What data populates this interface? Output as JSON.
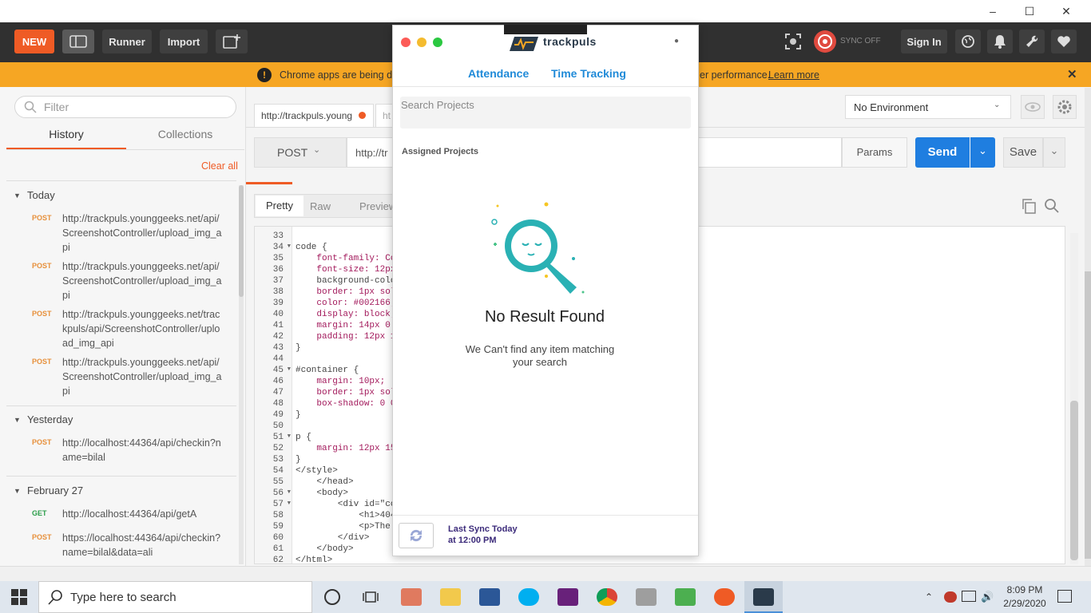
{
  "toolbar": {
    "new_label": "NEW",
    "runner_label": "Runner",
    "import_label": "Import",
    "sync_label": "SYNC OFF",
    "signin_label": "Sign In"
  },
  "banner": {
    "text_left": "Chrome apps are being de",
    "text_right": "er performance.",
    "link": "Learn more"
  },
  "sidebar": {
    "filter_placeholder": "Filter",
    "tabs": [
      "History",
      "Collections"
    ],
    "clear_all": "Clear all",
    "groups": [
      {
        "name": "Today",
        "items": [
          {
            "method": "POST",
            "url": "http://trackpuls.younggeeks.net/api/ScreenshotController/upload_img_api"
          },
          {
            "method": "POST",
            "url": "http://trackpuls.younggeeks.net/api/ScreenshotController/upload_img_api"
          },
          {
            "method": "POST",
            "url": "http://trackpuls.younggeeks.net/trackpuls/api/ScreenshotController/upload_img_api"
          },
          {
            "method": "POST",
            "url": "http://trackpuls.younggeeks.net/api/ScreenshotController/upload_img_api"
          }
        ]
      },
      {
        "name": "Yesterday",
        "items": [
          {
            "method": "POST",
            "url": "http://localhost:44364/api/checkin?name=bilal"
          }
        ]
      },
      {
        "name": "February 27",
        "items": [
          {
            "method": "GET",
            "url": "http://localhost:44364/api/getA"
          },
          {
            "method": "POST",
            "url": "https://localhost:44364/api/checkin?name=bilal&data=ali"
          }
        ]
      }
    ]
  },
  "request": {
    "tab_url": "http://trackpuls.young",
    "tab2": "ht",
    "method": "POST",
    "url": "http://tr",
    "params": "Params",
    "send": "Send",
    "save": "Save",
    "environment": "No Environment"
  },
  "response": {
    "tabs": [
      "Pretty",
      "Raw",
      "Preview"
    ]
  },
  "code_lines": [
    {
      "n": "33",
      "t": ""
    },
    {
      "n": "34",
      "t": "code {"
    },
    {
      "n": "35",
      "t": "    font-family: Co"
    },
    {
      "n": "36",
      "t": "    font-size: 12px"
    },
    {
      "n": "37",
      "t": "    background-colo"
    },
    {
      "n": "38",
      "t": "    border: 1px sol"
    },
    {
      "n": "39",
      "t": "    color: #002166;"
    },
    {
      "n": "40",
      "t": "    display: block;"
    },
    {
      "n": "41",
      "t": "    margin: 14px 0"
    },
    {
      "n": "42",
      "t": "    padding: 12px 1"
    },
    {
      "n": "43",
      "t": "}"
    },
    {
      "n": "44",
      "t": ""
    },
    {
      "n": "45",
      "t": "#container {"
    },
    {
      "n": "46",
      "t": "    margin: 10px;"
    },
    {
      "n": "47",
      "t": "    border: 1px sol"
    },
    {
      "n": "48",
      "t": "    box-shadow: 0 0"
    },
    {
      "n": "49",
      "t": "}"
    },
    {
      "n": "50",
      "t": ""
    },
    {
      "n": "51",
      "t": "p {"
    },
    {
      "n": "52",
      "t": "    margin: 12px 15"
    },
    {
      "n": "53",
      "t": "}"
    },
    {
      "n": "54",
      "t": "</style>"
    },
    {
      "n": "55",
      "t": "    </head>"
    },
    {
      "n": "56",
      "t": "    <body>"
    },
    {
      "n": "57",
      "t": "        <div id=\"co"
    },
    {
      "n": "58",
      "t": "            <h1>404"
    },
    {
      "n": "59",
      "t": "            <p>The"
    },
    {
      "n": "60",
      "t": "        </div>"
    },
    {
      "n": "61",
      "t": "    </body>"
    },
    {
      "n": "62",
      "t": "</html>"
    }
  ],
  "popup": {
    "app_name": "trackpuls",
    "tabs": [
      "Attendance",
      "Time Tracking"
    ],
    "search_placeholder": "Search Projects",
    "section_title": "Assigned Projects",
    "empty_title": "No Result Found",
    "empty_sub": "We Can't find any item matching your search",
    "sync_line1": "Last Sync Today",
    "sync_line2": "at 12:00 PM"
  },
  "taskbar": {
    "search_placeholder": "Type here to search",
    "time": "8:09 PM",
    "date": "2/29/2020"
  },
  "colors": {
    "postman_orange": "#ef5b25",
    "send_blue": "#1f7ee0",
    "banner": "#f6a623",
    "popup_accent": "#1f8ad8",
    "teal": "#2ab1b4"
  }
}
